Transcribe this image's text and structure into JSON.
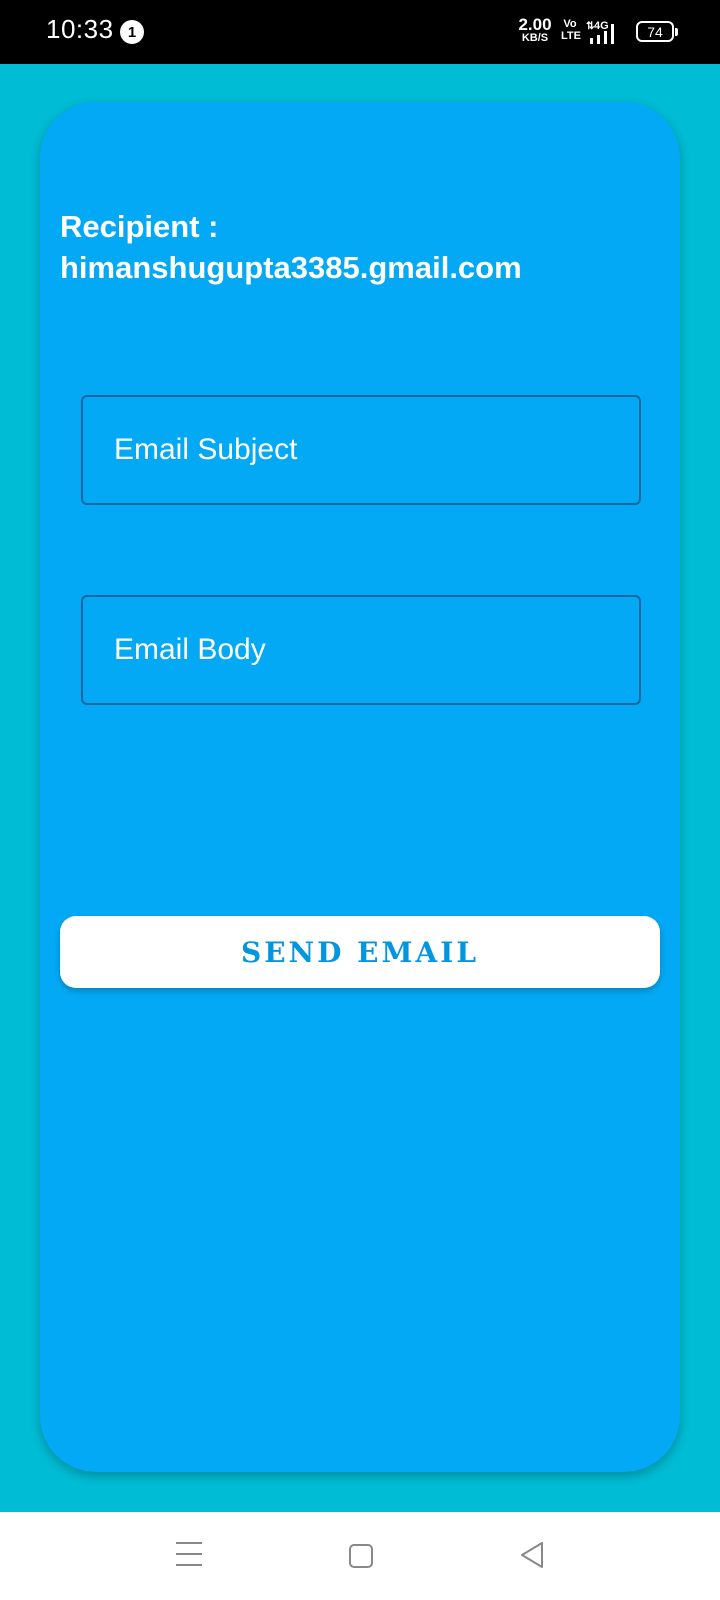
{
  "status_bar": {
    "time": "10:33",
    "notification_count": "1",
    "net_speed_value": "2.00",
    "net_speed_unit": "KB/S",
    "volte_top": "Vo",
    "volte_bottom": "LTE",
    "network_type": "4G",
    "battery_level": "74"
  },
  "form": {
    "recipient_label": "Recipient :",
    "recipient_value": "himanshugupta3385.gmail.com",
    "subject_placeholder": "Email Subject",
    "body_placeholder": "Email Body",
    "send_label": "SEND EMAIL"
  },
  "nav_bar": {
    "menu_icon": "menu-icon",
    "home_icon": "home-icon",
    "back_icon": "back-icon"
  },
  "colors": {
    "page_background": "#00BCD4",
    "card_background": "#03A9F4",
    "button_text": "#0396E0",
    "status_bar": "#000000"
  }
}
